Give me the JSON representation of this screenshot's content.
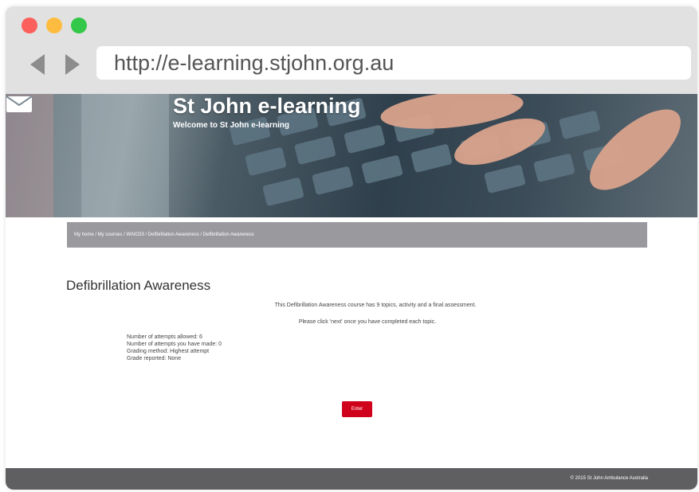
{
  "browser": {
    "url": "http://e-learning.stjohn.org.au"
  },
  "header": {
    "site_title": "St John e-learning",
    "site_subtitle": "Welcome to St John e-learning"
  },
  "breadcrumb": "My home / My courses / WAIO33 / Defibrillation Awareness / Defibrillation Awareness",
  "main": {
    "title": "Defibrillation Awareness",
    "intro_line1": "This Defibrillation Awareness course has 9 topics, activity and a final assessment.",
    "intro_line2": "Please click 'next' once you have completed each topic.",
    "attempts": [
      "Number of attempts allowed: 6",
      "Number of attempts you have made: 0",
      "Grading method: Highest attempt",
      "Grade reported: None"
    ],
    "enter_label": "Enter"
  },
  "footer": {
    "copyright": "© 2015 St John Ambulance Australia"
  },
  "colors": {
    "accent": "#d0021b",
    "breadcrumb_bg": "#9a999e",
    "footer_bg": "#5f5f61"
  }
}
